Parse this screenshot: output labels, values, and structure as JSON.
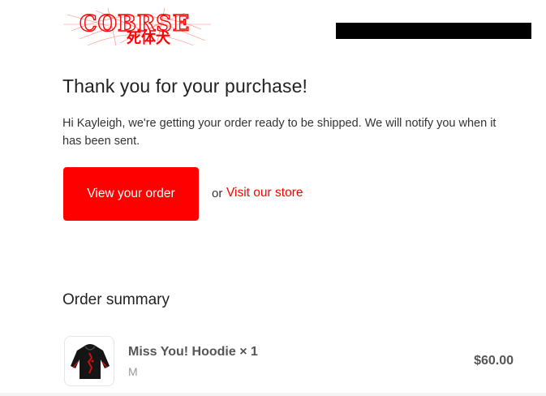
{
  "header": {
    "logo_text": "COBRSE",
    "logo_subtext": "死体犬",
    "redacted_block": ""
  },
  "main": {
    "title": "Thank you for your purchase!",
    "message": "Hi Kayleigh, we're getting your order ready to be shipped. We will notify you when it has been sent.",
    "cta_label": "View your order",
    "or_text": "or",
    "store_link_label": "Visit our store"
  },
  "summary": {
    "heading": "Order summary",
    "items": [
      {
        "name": "Miss You! Hoodie × 1",
        "variant": "M",
        "price": "$60.00",
        "icon": "hoodie-image"
      }
    ]
  },
  "colors": {
    "accent": "#ff0000",
    "text": "#222222",
    "muted": "#999999"
  }
}
